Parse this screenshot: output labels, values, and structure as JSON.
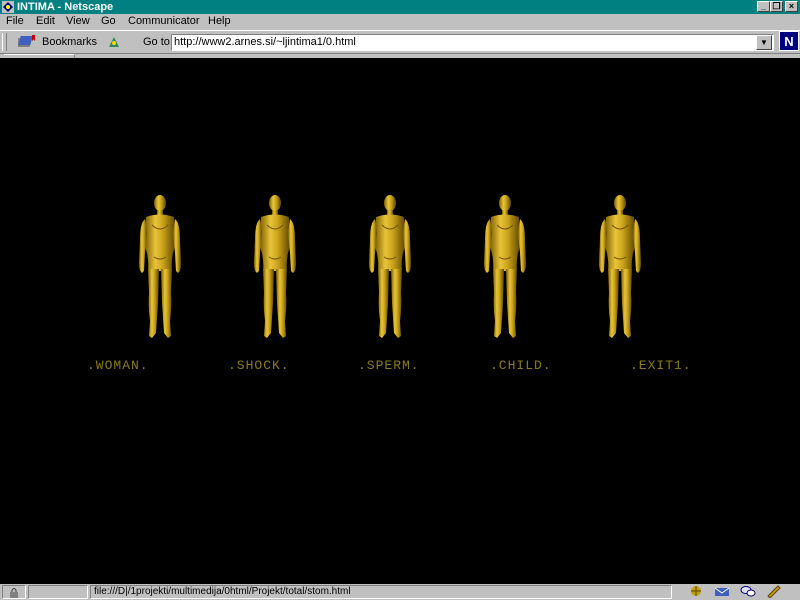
{
  "window": {
    "title": "INTIMA - Netscape"
  },
  "menu": {
    "items": [
      {
        "label": "File",
        "key": "F"
      },
      {
        "label": "Edit",
        "key": "E"
      },
      {
        "label": "View",
        "key": "V"
      },
      {
        "label": "Go",
        "key": "G"
      },
      {
        "label": "Communicator",
        "key": "C"
      },
      {
        "label": "Help",
        "key": "H"
      }
    ]
  },
  "toolbar": {
    "bookmarks_label": "Bookmarks",
    "goto_label": "Go to:",
    "url": "http://www2.arnes.si/~ljintima1/0.html"
  },
  "content": {
    "background": "#000000",
    "figure_color": "#c9a21a",
    "links": [
      {
        "label": ".WOMAN."
      },
      {
        "label": ".SHOCK."
      },
      {
        "label": ".SPERM."
      },
      {
        "label": ".CHILD."
      },
      {
        "label": ".EXIT1."
      }
    ]
  },
  "status": {
    "text": "file:///D|/1projekti/multimedija/0html/Projekt/total/stom.html"
  },
  "colors": {
    "titlebar": "#008080",
    "chrome": "#c0c0c0",
    "link": "#8a7a1c"
  }
}
